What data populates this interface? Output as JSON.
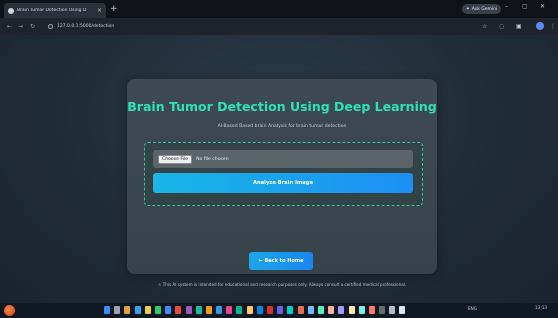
{
  "browser": {
    "tab_title": "Brain Tumor Detection Using D",
    "tab_close": "×",
    "new_tab": "+",
    "gemini_label": "Ask Gemini",
    "url": "127.0.0.1:5000/detection",
    "win_min": "–",
    "win_max": "▢",
    "win_close": "✕"
  },
  "page": {
    "title": "Brain Tumor Detection Using Deep Learning",
    "subtitle": "AI-Based Based brain Analysis for brain tumor detection",
    "file_input": {
      "button_label": "Choose File",
      "status": "No file chosen"
    },
    "analyze_label": "Analyze Brain Image",
    "home_label": "← Back to Home",
    "disclaimer": "⚠ This AI system is intended for educational and research purposes only. Always consult a certified medical professional."
  },
  "taskbar": {
    "tray_lang": "ENG",
    "time": "13:13"
  },
  "colors": {
    "accent_title": "#2fe3b0",
    "button_blue": "#1c8ff3",
    "card_bg": "#3e4a51"
  }
}
